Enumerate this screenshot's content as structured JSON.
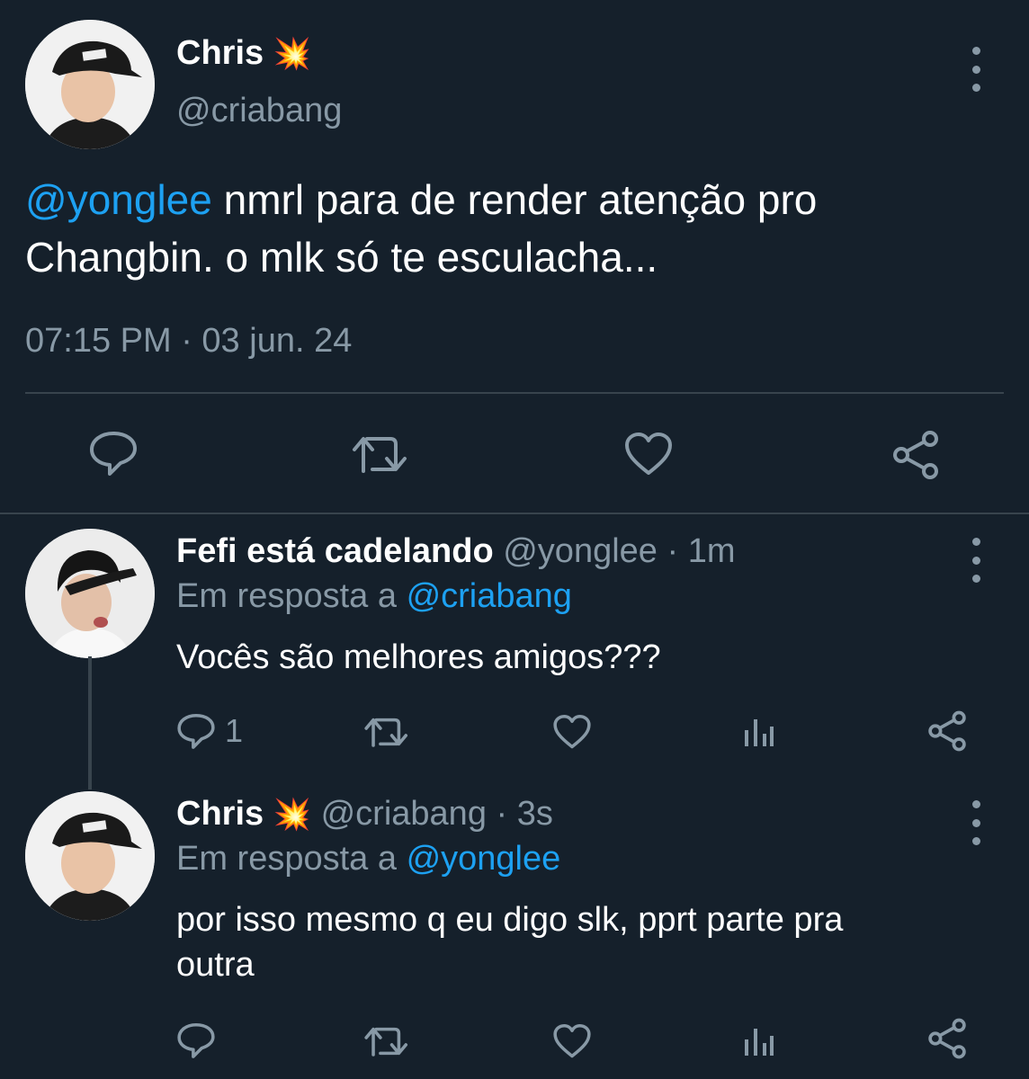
{
  "main_tweet": {
    "author_name": "Chris",
    "author_emoji": "💥",
    "handle": "@criabang",
    "mention": "@yonglee",
    "text_line1": " nmrl para de render atenção pro",
    "text_line2": "Changbin. o mlk só te esculacha...",
    "timestamp": "07:15 PM · 03 jun. 24"
  },
  "reply1": {
    "author_name": "Fefi está cadelando",
    "meta": "@yonglee · 1m",
    "replying_to_label": "Em resposta a",
    "replying_to_handle": "@criabang",
    "text": "Vocês são melhores amigos???",
    "reply_count": "1"
  },
  "reply2": {
    "author_name": "Chris",
    "author_emoji": "💥",
    "meta": "@criabang · 3s",
    "replying_to_label": "Em resposta a",
    "replying_to_handle": "@yonglee",
    "text_line1": "por isso mesmo q eu digo slk, pprt parte pra",
    "text_line2": "outra"
  },
  "icons": [
    "reply-icon",
    "retweet-icon",
    "like-icon",
    "share-icon",
    "analytics-icon",
    "more-icon"
  ],
  "colors": {
    "background": "#15202b",
    "text": "#ffffff",
    "muted": "#8899a6",
    "link": "#1da1f2",
    "divider": "#38444d"
  }
}
